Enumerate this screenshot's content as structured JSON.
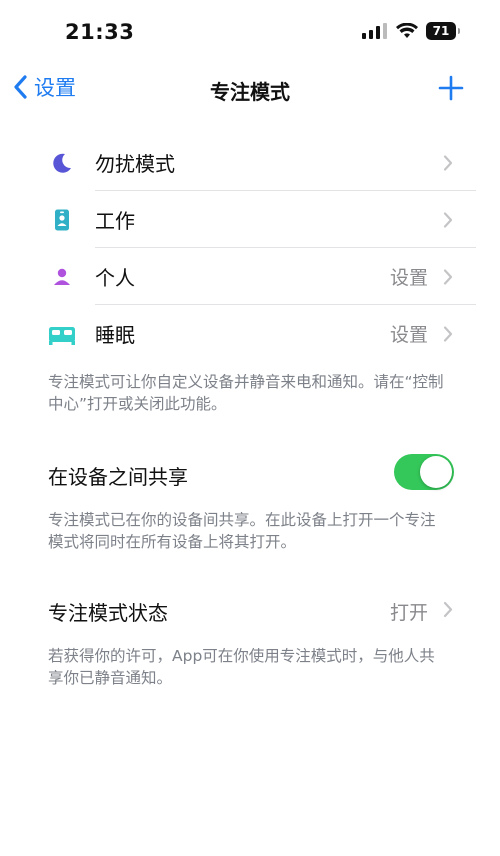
{
  "status_bar": {
    "time": "21:33",
    "battery": "71"
  },
  "nav": {
    "back_label": "设置",
    "title": "专注模式"
  },
  "focus_modes": [
    {
      "name": "moon-icon",
      "label": "勿扰模式",
      "value": "",
      "color": "#5856d6"
    },
    {
      "name": "badge-icon",
      "label": "工作",
      "value": "",
      "color": "#30b0c7"
    },
    {
      "name": "person-icon",
      "label": "个人",
      "value": "设置",
      "color": "#af52de"
    },
    {
      "name": "bed-icon",
      "label": "睡眠",
      "value": "设置",
      "color": "#32d0c8"
    }
  ],
  "notes": {
    "modes": "专注模式可让你自定义设备并静音来电和通知。请在“控制中心”打开或关闭此功能。",
    "share": "专注模式已在你的设备间共享。在此设备上打开一个专注模式将同时在所有设备上将其打开。",
    "status": "若获得你的许可，App可在你使用专注模式时，与他人共享你已静音通知。"
  },
  "share_across_devices": {
    "label": "在设备之间共享",
    "enabled": true
  },
  "focus_status": {
    "label": "专注模式状态",
    "value": "打开"
  },
  "colors": {
    "accent": "#1f7cf0",
    "toggle_on": "#34c759"
  }
}
